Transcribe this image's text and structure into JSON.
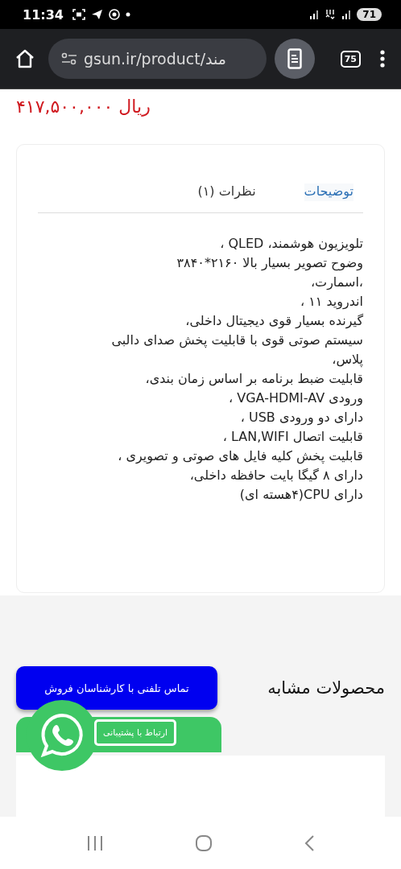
{
  "status_bar": {
    "time": "11:34",
    "battery": "71"
  },
  "browser": {
    "url": "gsun.ir/product/مند",
    "tab_count": "75"
  },
  "price": "ریال ۴۱۷,۵۰۰,۰۰۰",
  "tabs": [
    {
      "label": "توضیحات",
      "selected": true
    },
    {
      "label": "نظرات (۱)",
      "selected": false
    }
  ],
  "description": [
    "تلویزیون هوشمند، QLED ،",
    "وضوح تصویر بسیار بالا ۲۱۶۰*۳۸۴۰",
    "،اسمارت،",
    "اندروید ۱۱ ،",
    "گیرنده بسیار قوی دیجیتال داخلی،",
    "سیستم صوتی قوی با قابلیت پخش صدای دالبی پلاس،",
    "قابلیت ضبط برنامه بر اساس زمان بندی،",
    "ورودی VGA-HDMI-AV ،",
    "دارای دو ورودی USB ،",
    "قابلیت اتصال LAN,WIFI ،",
    "قابلیت پخش کلیه فایل های صوتی و تصویری ،",
    "دارای ۸ گیگا بایت حافظه داخلی،",
    "دارای CPU(۴هسته ای)"
  ],
  "similar_products": {
    "title": "محصولات مشابه"
  },
  "call_button": "تماس تلفنی با کارشناسان فروش",
  "support_button": "ارتباط با پشتیبانی"
}
